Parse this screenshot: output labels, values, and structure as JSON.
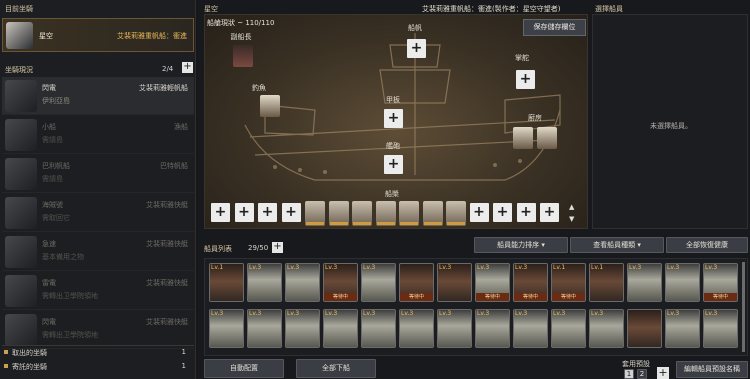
{
  "left": {
    "current_title": "目前坐騎",
    "current": {
      "name": "星空",
      "type": "艾裴莉雅重帆船：衝進"
    },
    "status_title": "坐騎現況",
    "count": "2/4",
    "vehicles": [
      {
        "name": "閃電",
        "sub": "伊利亞島",
        "type": "艾裴莉雅輕帆船",
        "dim": false
      },
      {
        "name": "小船",
        "sub": "需請島",
        "type": "漁船",
        "dim": true
      },
      {
        "name": "巴利帆船",
        "sub": "需請島",
        "type": "巴特帆船",
        "dim": true
      },
      {
        "name": "海賊號",
        "sub": "需取回它",
        "type": "艾裴莉雅快艇",
        "dim": true
      },
      {
        "name": "急速",
        "sub": "基本備用之物",
        "type": "艾裴莉雅快艇",
        "dim": true
      },
      {
        "name": "雷電",
        "sub": "需轉出卫學院領地",
        "type": "艾裴莉雅快艇",
        "dim": true
      },
      {
        "name": "閃電",
        "sub": "需轉出卫學院領地",
        "type": "艾裴莉雅快艇",
        "dim": true
      }
    ],
    "footer": [
      {
        "label": "取出的坐騎",
        "value": "1"
      },
      {
        "label": "寄託的坐騎",
        "value": "1"
      }
    ]
  },
  "ship": {
    "name": "星空",
    "title": "艾裴莉雅重帆船：衝進(製作者：星空守望者)",
    "capacity": "船艙現狀 ~ 110/110",
    "save_button": "保存儲存欄位",
    "positions": {
      "first_mate": "副船長",
      "sail": "船帆",
      "fisher": "釣魚",
      "helm": "掌舵",
      "deck": "甲板",
      "kitchen": "廚房",
      "cabin": "艦砲",
      "rowers": "船槳"
    },
    "rower_slots": [
      false,
      false,
      false,
      false,
      true,
      true,
      true,
      true,
      true,
      true,
      true,
      false,
      false,
      false,
      false
    ]
  },
  "right_panel": {
    "title": "選擇船員",
    "empty_text": "未選擇船員。"
  },
  "crew": {
    "title": "船員列表",
    "count": "29/50",
    "sort_button": "船員能力排序",
    "type_button": "查看船員種類",
    "recover_button": "全部恢復健康",
    "auto_button": "自動配置",
    "unassign_button": "全部下船",
    "preset_label": "套用預設",
    "preset_pages": [
      "1",
      "2"
    ],
    "edit_preset_button": "編輯船員預設名稱",
    "cards": [
      {
        "lv": "Lv.1",
        "status": "",
        "portrait": "human"
      },
      {
        "lv": "Lv.3",
        "status": "",
        "portrait": "goblin"
      },
      {
        "lv": "Lv.3",
        "status": "",
        "portrait": "goblin"
      },
      {
        "lv": "Lv.3",
        "status": "等待中",
        "portrait": "human"
      },
      {
        "lv": "Lv.3",
        "status": "",
        "portrait": "goblin"
      },
      {
        "lv": "",
        "status": "等待中",
        "portrait": "human"
      },
      {
        "lv": "Lv.3",
        "status": "",
        "portrait": "human"
      },
      {
        "lv": "Lv.3",
        "status": "等待中",
        "portrait": "goblin"
      },
      {
        "lv": "Lv.3",
        "status": "等待中",
        "portrait": "human"
      },
      {
        "lv": "Lv.1",
        "status": "等待中",
        "portrait": "human"
      },
      {
        "lv": "Lv.1",
        "status": "",
        "portrait": "human"
      },
      {
        "lv": "Lv.3",
        "status": "",
        "portrait": "goblin"
      },
      {
        "lv": "Lv.3",
        "status": "",
        "portrait": "goblin"
      },
      {
        "lv": "Lv.3",
        "status": "等待中",
        "portrait": "goblin"
      },
      {
        "lv": "Lv.3",
        "status": "",
        "portrait": "goblin"
      },
      {
        "lv": "Lv.3",
        "status": "",
        "portrait": "goblin"
      },
      {
        "lv": "Lv.3",
        "status": "",
        "portrait": "goblin"
      },
      {
        "lv": "Lv.3",
        "status": "",
        "portrait": "goblin"
      },
      {
        "lv": "Lv.3",
        "status": "",
        "portrait": "goblin"
      },
      {
        "lv": "Lv.3",
        "status": "",
        "portrait": "goblin"
      },
      {
        "lv": "Lv.3",
        "status": "",
        "portrait": "goblin"
      },
      {
        "lv": "Lv.3",
        "status": "",
        "portrait": "goblin"
      },
      {
        "lv": "Lv.3",
        "status": "",
        "portrait": "goblin"
      },
      {
        "lv": "Lv.3",
        "status": "",
        "portrait": "goblin"
      },
      {
        "lv": "Lv.3",
        "status": "",
        "portrait": "goblin"
      },
      {
        "lv": "",
        "status": "",
        "portrait": "human"
      },
      {
        "lv": "Lv.3",
        "status": "",
        "portrait": "goblin"
      },
      {
        "lv": "Lv.3",
        "status": "",
        "portrait": "goblin"
      }
    ]
  },
  "colors": {
    "accent": "#c9a24a",
    "status_bar": "#6b2a12",
    "panel": "#1c1e22"
  }
}
